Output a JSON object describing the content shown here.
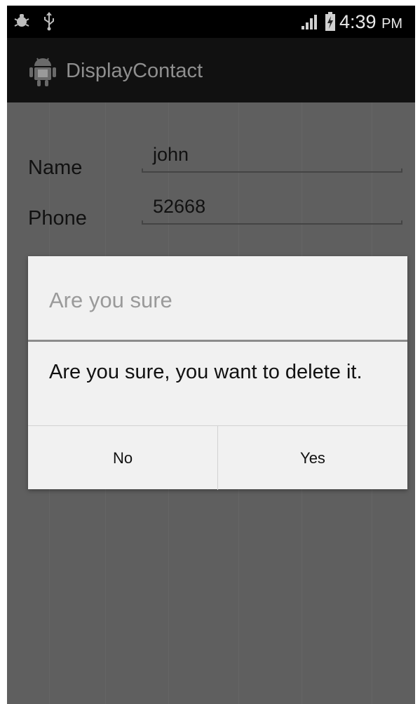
{
  "status_bar": {
    "time": "4:39",
    "ampm": "PM",
    "icons": [
      "debug-bug-icon",
      "usb-icon",
      "signal-strength-icon",
      "battery-charging-icon"
    ]
  },
  "action_bar": {
    "title": "DisplayContact",
    "icon": "android-app-icon"
  },
  "form": {
    "fields": [
      {
        "label": "Name",
        "value": "john"
      },
      {
        "label": "Phone",
        "value": "52668"
      }
    ]
  },
  "dialog": {
    "title": "Are you sure",
    "message": "Are you sure, you want to delete it.",
    "negative_button": "No",
    "positive_button": "Yes"
  },
  "colors": {
    "dim_background": "#5f5f5f",
    "dialog_background": "#f1f1f1",
    "action_bar": "#111111",
    "status_bar": "#000000"
  }
}
